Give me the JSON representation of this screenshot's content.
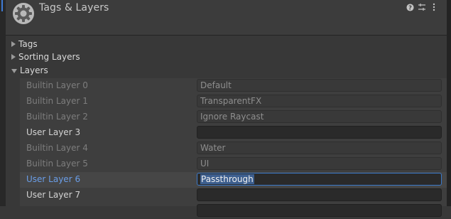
{
  "window": {
    "title": "Tags & Layers",
    "header_icons": [
      "help-icon",
      "preset-sliders-icon",
      "more-menu-icon"
    ]
  },
  "sections": {
    "tags": "Tags",
    "sorting_layers": "Sorting Layers",
    "layers": "Layers"
  },
  "layers": [
    {
      "label": "Builtin Layer 0",
      "value": "Default",
      "builtin": true
    },
    {
      "label": "Builtin Layer 1",
      "value": "TransparentFX",
      "builtin": true
    },
    {
      "label": "Builtin Layer 2",
      "value": "Ignore Raycast",
      "builtin": true
    },
    {
      "label": "User Layer 3",
      "value": "",
      "builtin": false
    },
    {
      "label": "Builtin Layer 4",
      "value": "Water",
      "builtin": true
    },
    {
      "label": "Builtin Layer 5",
      "value": "UI",
      "builtin": true
    },
    {
      "label": "User Layer 6",
      "value": "Passthrough",
      "builtin": false,
      "editing": true
    },
    {
      "label": "User Layer 7",
      "value": "",
      "builtin": false
    }
  ],
  "colors": {
    "focus_accent": "#3a79c9",
    "active_label": "#6a9ee8",
    "text_selection": "#3d5f8f"
  }
}
